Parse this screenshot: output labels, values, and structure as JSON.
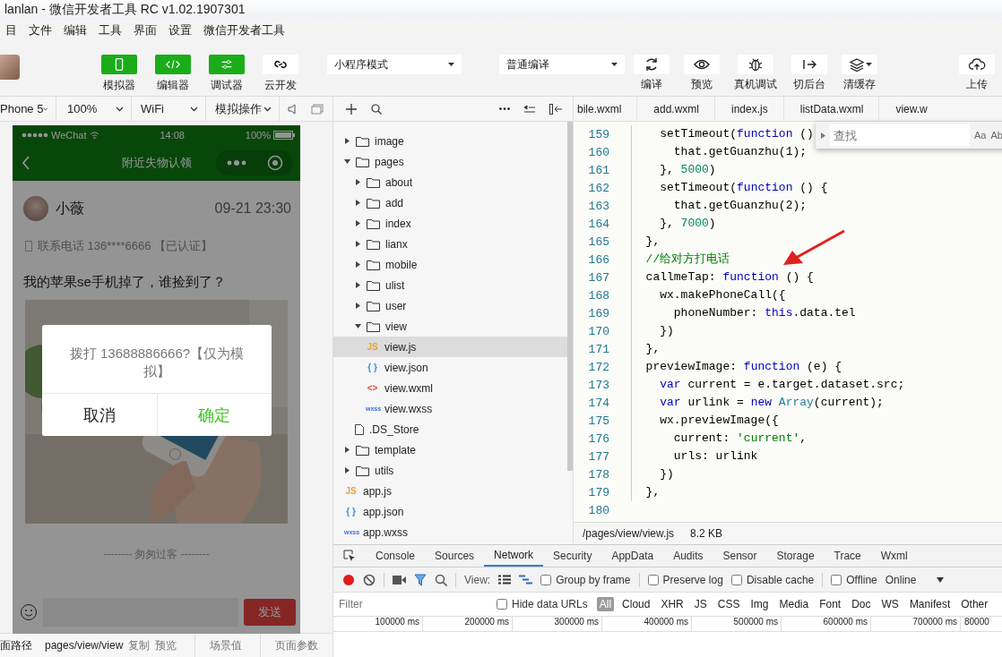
{
  "window": {
    "title": "lanlan - 微信开发者工具 RC v1.02.1907301"
  },
  "menu": [
    "目",
    "文件",
    "编辑",
    "工具",
    "界面",
    "设置",
    "微信开发者工具"
  ],
  "toolbar": {
    "buttons": [
      {
        "label": "模拟器",
        "active": true
      },
      {
        "label": "编辑器",
        "active": true
      },
      {
        "label": "调试器",
        "active": true
      },
      {
        "label": "云开发",
        "active": false
      }
    ],
    "mode_select": "小程序模式",
    "compile_select": "普通编译",
    "actions": [
      {
        "label": "编译"
      },
      {
        "label": "预览"
      },
      {
        "label": "真机调试"
      },
      {
        "label": "切后台"
      },
      {
        "label": "清缓存"
      },
      {
        "label": "上传"
      }
    ]
  },
  "simulator_bar": {
    "selects": [
      "Phone 5",
      "100%",
      "WiFi",
      "模拟操作"
    ]
  },
  "simulator": {
    "status": {
      "carrier": "WeChat",
      "time": "14:08",
      "battery": "100%"
    },
    "nav_title": "附近失物认领",
    "post": {
      "user": "小薇",
      "time": "09-21 23:30",
      "contact": "联系电话 136****6666 【已认证】",
      "text": "我的苹果se手机掉了，谁捡到了？"
    },
    "divider_text": "-------- 匆匆过客 --------",
    "send_label": "发送",
    "dialog": {
      "message": "拨打 13688886666?【仅为模拟】",
      "cancel": "取消",
      "confirm": "确定"
    }
  },
  "page_bar": {
    "path_label": "面路径",
    "path": "pages/view/view",
    "copy": "复制",
    "preview": "预览",
    "scene": "场景值",
    "params": "页面参数"
  },
  "file_tree": [
    {
      "name": "image",
      "kind": "folder",
      "expanded": false,
      "selected": false
    },
    {
      "name": "pages",
      "kind": "folder",
      "expanded": true,
      "selected": false,
      "children": [
        {
          "name": "about",
          "kind": "folder",
          "expanded": false,
          "selected": false
        },
        {
          "name": "add",
          "kind": "folder",
          "expanded": false,
          "selected": false
        },
        {
          "name": "index",
          "kind": "folder",
          "expanded": false,
          "selected": false
        },
        {
          "name": "lianx",
          "kind": "folder",
          "expanded": false,
          "selected": false
        },
        {
          "name": "mobile",
          "kind": "folder",
          "expanded": false,
          "selected": false
        },
        {
          "name": "ulist",
          "kind": "folder",
          "expanded": false,
          "selected": false
        },
        {
          "name": "user",
          "kind": "folder",
          "expanded": false,
          "selected": false
        },
        {
          "name": "view",
          "kind": "folder",
          "expanded": true,
          "selected": false,
          "children": [
            {
              "name": "view.js",
              "kind": "js",
              "badge": "JS",
              "selected": true
            },
            {
              "name": "view.json",
              "kind": "json",
              "badge": "{ }",
              "selected": false
            },
            {
              "name": "view.wxml",
              "kind": "wxml",
              "badge": "<>",
              "selected": false
            },
            {
              "name": "view.wxss",
              "kind": "wxss",
              "badge": "wxss",
              "selected": false
            }
          ]
        },
        {
          "name": ".DS_Store",
          "kind": "file",
          "selected": false
        }
      ]
    },
    {
      "name": "template",
      "kind": "folder",
      "expanded": false,
      "selected": false
    },
    {
      "name": "utils",
      "kind": "folder",
      "expanded": false,
      "selected": false
    },
    {
      "name": "app.js",
      "kind": "js",
      "badge": "JS",
      "selected": false
    },
    {
      "name": "app.json",
      "kind": "json",
      "badge": "{ }",
      "selected": false
    },
    {
      "name": "app.wxss",
      "kind": "wxss",
      "badge": "wxss",
      "selected": false
    }
  ],
  "editor": {
    "tabs": [
      {
        "label": "bile.wxml"
      },
      {
        "label": "add.wxml"
      },
      {
        "label": "index.js"
      },
      {
        "label": "listData.wxml"
      },
      {
        "label": "view.w"
      }
    ],
    "find": {
      "placeholder": "查找",
      "options": [
        "Aa",
        "Ab"
      ]
    },
    "lines": [
      {
        "number": "159",
        "tokens": [
          {
            "text": "    setTimeout(",
            "kind": "plain"
          },
          {
            "text": "function",
            "kind": "keyword"
          },
          {
            "text": " ()",
            "kind": "plain"
          }
        ]
      },
      {
        "number": "160",
        "tokens": [
          {
            "text": "      that.getGuanzhu(1);",
            "kind": "plain"
          }
        ]
      },
      {
        "number": "161",
        "tokens": [
          {
            "text": "    }, ",
            "kind": "plain"
          },
          {
            "text": "5000",
            "kind": "number"
          },
          {
            "text": ")",
            "kind": "plain"
          }
        ]
      },
      {
        "number": "162",
        "tokens": [
          {
            "text": "    setTimeout(",
            "kind": "plain"
          },
          {
            "text": "function",
            "kind": "keyword"
          },
          {
            "text": " () {",
            "kind": "plain"
          }
        ]
      },
      {
        "number": "163",
        "tokens": [
          {
            "text": "      that.getGuanzhu(2);",
            "kind": "plain"
          }
        ]
      },
      {
        "number": "164",
        "tokens": [
          {
            "text": "    }, ",
            "kind": "plain"
          },
          {
            "text": "7000",
            "kind": "number"
          },
          {
            "text": ")",
            "kind": "plain"
          }
        ]
      },
      {
        "number": "165",
        "tokens": [
          {
            "text": "  },",
            "kind": "plain"
          }
        ]
      },
      {
        "number": "166",
        "tokens": [
          {
            "text": "  //给对方打电话",
            "kind": "comment"
          }
        ]
      },
      {
        "number": "167",
        "tokens": [
          {
            "text": "  callmeTap: ",
            "kind": "plain"
          },
          {
            "text": "function",
            "kind": "keyword"
          },
          {
            "text": " () {",
            "kind": "plain"
          }
        ]
      },
      {
        "number": "168",
        "tokens": [
          {
            "text": "    wx.makePhoneCall({",
            "kind": "plain"
          }
        ]
      },
      {
        "number": "169",
        "tokens": [
          {
            "text": "      phoneNumber: ",
            "kind": "plain"
          },
          {
            "text": "this",
            "kind": "keyword"
          },
          {
            "text": ".data.tel",
            "kind": "plain"
          }
        ]
      },
      {
        "number": "170",
        "tokens": [
          {
            "text": "    })",
            "kind": "plain"
          }
        ]
      },
      {
        "number": "171",
        "tokens": [
          {
            "text": "  },",
            "kind": "plain"
          }
        ]
      },
      {
        "number": "172",
        "tokens": [
          {
            "text": "  previewImage: ",
            "kind": "plain"
          },
          {
            "text": "function",
            "kind": "keyword"
          },
          {
            "text": " (e) {",
            "kind": "plain"
          }
        ]
      },
      {
        "number": "173",
        "tokens": [
          {
            "text": "    var",
            "kind": "keyword"
          },
          {
            "text": " current = e.target.dataset.src;",
            "kind": "plain"
          }
        ]
      },
      {
        "number": "174",
        "tokens": [
          {
            "text": "    var",
            "kind": "keyword"
          },
          {
            "text": " urlink = ",
            "kind": "plain"
          },
          {
            "text": "new ",
            "kind": "keyword"
          },
          {
            "text": "Array",
            "kind": "builtin"
          },
          {
            "text": "(current);",
            "kind": "plain"
          }
        ]
      },
      {
        "number": "175",
        "tokens": [
          {
            "text": "    wx.previewImage({",
            "kind": "plain"
          }
        ]
      },
      {
        "number": "176",
        "tokens": [
          {
            "text": "      current: ",
            "kind": "plain"
          },
          {
            "text": "'current'",
            "kind": "string"
          },
          {
            "text": ",",
            "kind": "plain"
          }
        ]
      },
      {
        "number": "177",
        "tokens": [
          {
            "text": "      urls: urlink",
            "kind": "plain"
          }
        ]
      },
      {
        "number": "178",
        "tokens": [
          {
            "text": "    })",
            "kind": "plain"
          }
        ]
      },
      {
        "number": "179",
        "tokens": [
          {
            "text": "  },",
            "kind": "plain"
          }
        ]
      },
      {
        "number": "180"
      }
    ],
    "status": {
      "path": "/pages/view/view.js",
      "size": "8.2 KB"
    }
  },
  "devtools": {
    "tabs": [
      {
        "label": "Console",
        "selected": false
      },
      {
        "label": "Sources",
        "selected": false
      },
      {
        "label": "Network",
        "selected": true
      },
      {
        "label": "Security",
        "selected": false
      },
      {
        "label": "AppData",
        "selected": false
      },
      {
        "label": "Audits",
        "selected": false
      },
      {
        "label": "Sensor",
        "selected": false
      },
      {
        "label": "Storage",
        "selected": false
      },
      {
        "label": "Trace",
        "selected": false
      },
      {
        "label": "Wxml",
        "selected": false
      }
    ],
    "view_label": "View:",
    "options": [
      {
        "label": "Group by frame",
        "checked": false
      },
      {
        "label": "Preserve log",
        "checked": false
      },
      {
        "label": "Disable cache",
        "checked": false
      },
      {
        "label": "Offline",
        "checked": false
      }
    ],
    "throttle": "Online",
    "filter": {
      "placeholder": "Filter",
      "hide_data_urls": {
        "label": "Hide data URLs",
        "checked": false
      },
      "types": [
        {
          "label": "All",
          "selected": true
        },
        {
          "label": "Cloud",
          "selected": false
        },
        {
          "label": "XHR",
          "selected": false
        },
        {
          "label": "JS",
          "selected": false
        },
        {
          "label": "CSS",
          "selected": false
        },
        {
          "label": "Img",
          "selected": false
        },
        {
          "label": "Media",
          "selected": false
        },
        {
          "label": "Font",
          "selected": false
        },
        {
          "label": "Doc",
          "selected": false
        },
        {
          "label": "WS",
          "selected": false
        },
        {
          "label": "Manifest",
          "selected": false
        },
        {
          "label": "Other",
          "selected": false
        }
      ]
    },
    "timeline": [
      "100000 ms",
      "200000 ms",
      "300000 ms",
      "400000 ms",
      "500000 ms",
      "600000 ms",
      "700000 ms",
      "80000"
    ]
  }
}
